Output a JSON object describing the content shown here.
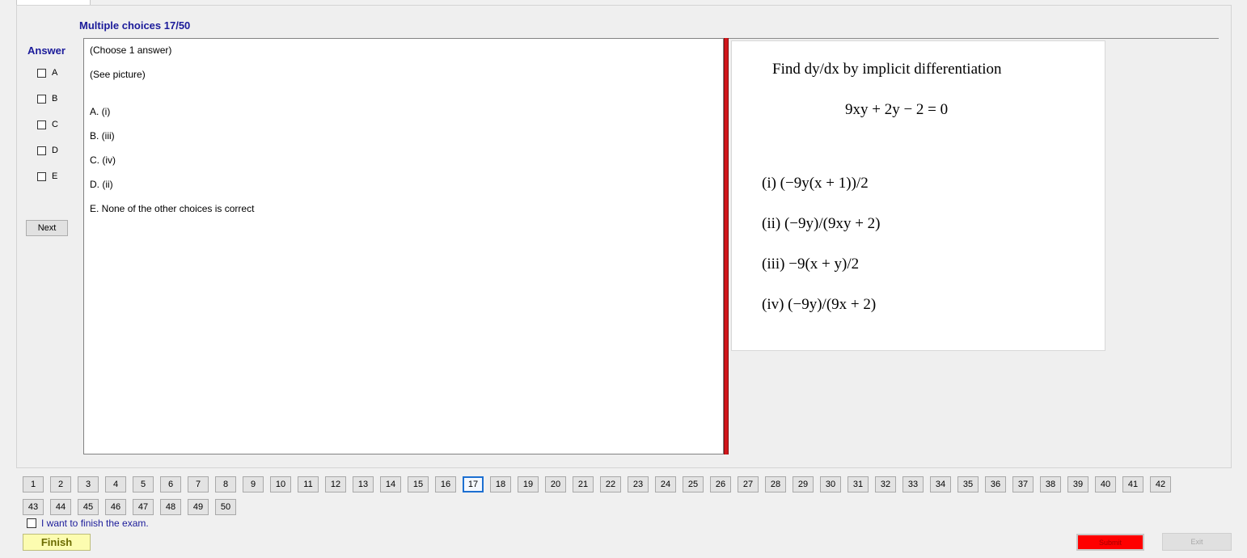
{
  "question": {
    "title": "Multiple choices 17/50",
    "answer_label": "Answer"
  },
  "answer_options": [
    "A",
    "B",
    "C",
    "D",
    "E"
  ],
  "next_label": "Next",
  "question_text": {
    "instruction": "(Choose 1 answer)",
    "see_picture": "(See picture)",
    "choices": [
      "A. (i)",
      "B. (iii)",
      "C. (iv)",
      "D. (ii)",
      "E.  None of the other choices is correct"
    ]
  },
  "picture": {
    "prompt": "Find dy/dx by implicit differentiation",
    "equation": "9xy + 2y − 2 = 0",
    "items": [
      "(i) (−9y(x + 1))/2",
      "(ii) (−9y)/(9xy + 2)",
      "(iii) −9(x + y)/2",
      "(iv) (−9y)/(9x + 2)"
    ]
  },
  "navigation": {
    "current": 17,
    "numbers": [
      "1",
      "2",
      "3",
      "4",
      "5",
      "6",
      "7",
      "8",
      "9",
      "10",
      "11",
      "12",
      "13",
      "14",
      "15",
      "16",
      "17",
      "18",
      "19",
      "20",
      "21",
      "22",
      "23",
      "24",
      "25",
      "26",
      "27",
      "28",
      "29",
      "30",
      "31",
      "32",
      "33",
      "34",
      "35",
      "36",
      "37",
      "38",
      "39",
      "40",
      "41",
      "42",
      "43",
      "44",
      "45",
      "46",
      "47",
      "48",
      "49",
      "50"
    ]
  },
  "finish_check_label": "I want to finish the exam.",
  "finish_label": "Finish",
  "submit_label": "Submit",
  "exit_label": "Exit",
  "colors": {
    "title_blue": "#1b1b9a",
    "splitter_red": "#d0161b",
    "submit_red": "#ff0000",
    "finish_yellow": "#fcfcb0",
    "current_border": "#1c6fd1"
  }
}
